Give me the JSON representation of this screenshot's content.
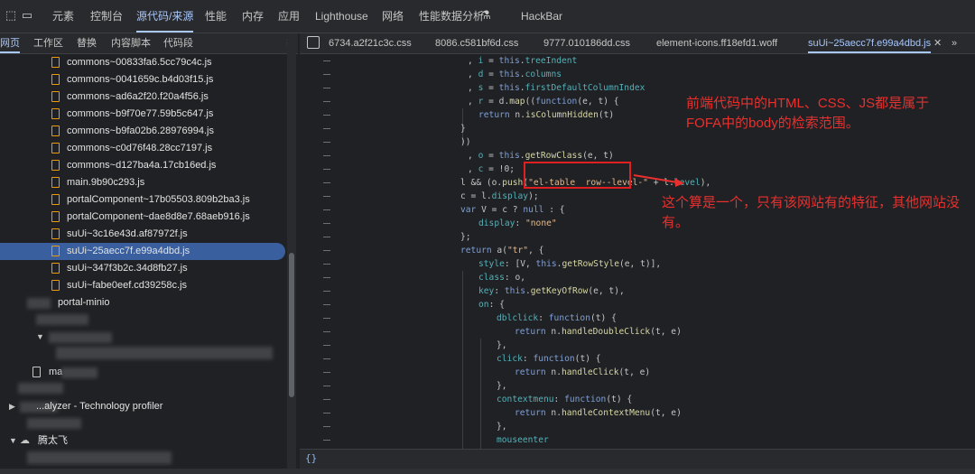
{
  "toolbar": {
    "icons": [
      "inspect-element-icon",
      "device-toolbar-icon"
    ],
    "tabs": [
      "元素",
      "控制台",
      "源代码/来源",
      "性能",
      "内存",
      "应用",
      "Lighthouse",
      "网络",
      "性能数据分析",
      "HackBar"
    ],
    "active_tab": "源代码/来源",
    "flask_icon": "flask-icon"
  },
  "sidebar": {
    "tabs": [
      "网页",
      "工作区",
      "替换",
      "内容脚本",
      "代码段"
    ],
    "more": "⋮",
    "files": [
      "commons~00833fa6.5cc79c4c.js",
      "commons~0041659c.b4d03f15.js",
      "commons~ad6a2f20.f20a4f56.js",
      "commons~b9f70e77.59b5c647.js",
      "commons~b9fa02b6.28976994.js",
      "commons~c0d76f48.28cc7197.js",
      "commons~d127ba4a.17cb16ed.js",
      "main.9b90c293.js",
      "portalComponent~17b05503.809b2ba3.js",
      "portalComponent~dae8d8e7.68aeb916.js",
      "suUi~3c16e43d.af87972f.js",
      "suUi~25aecc7f.e99a4dbd.js",
      "suUi~347f3b2c.34d8fb27.js",
      "suUi~fabe0eef.cd39258c.js"
    ],
    "selected_file": "suUi~25aecc7f.e99a4dbd.js",
    "folder_portal": "portal-minio",
    "file_ma": "ma",
    "profiler": "...alyzer - Technology profiler",
    "cloud_label": "腾太飞"
  },
  "editor": {
    "tabs": [
      "6734.a2f21c3c.css",
      "8086.c581bf6d.css",
      "9777.010186dd.css",
      "element-icons.ff18efd1.woff",
      "suUi~25aecc7f.e99a4dbd.js"
    ],
    "active_tab": "suUi~25aecc7f.e99a4dbd.js",
    "overflow": "»",
    "close": "✕",
    "statusbar_braces": "{}"
  },
  "annotations": {
    "note1": "前端代码中的HTML、CSS、JS都是属于FOFA中的body的检索范围。",
    "note2": "这个算是一个，只有该网站有的特征，其他网站没有。",
    "color": "#e8302e"
  }
}
